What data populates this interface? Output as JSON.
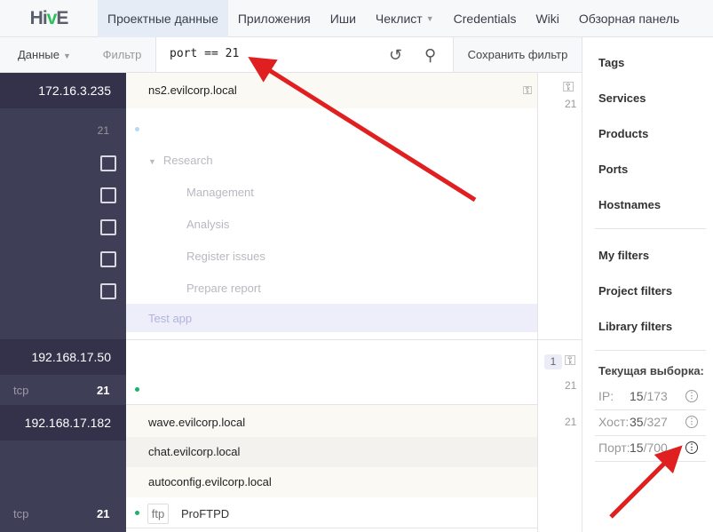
{
  "nav": {
    "logo": "HivE",
    "items": [
      "Проектные данные",
      "Приложения",
      "Иши",
      "Чеклист",
      "Credentials",
      "Wiki",
      "Обзорная панель"
    ]
  },
  "toolbar": {
    "data": "Данные",
    "filter": "Фильтр",
    "query": "port == 21",
    "save": "Сохранить фильтр"
  },
  "rows": [
    {
      "ip": "172.16.3.235",
      "hostnames": [
        "ns2.evilcorp.local"
      ],
      "port": "21",
      "port_count": "21"
    },
    {
      "ip": "192.168.17.50",
      "proto": "tcp",
      "port": "21",
      "badge": "1",
      "port_count": "21"
    },
    {
      "ip": "192.168.17.182",
      "hostnames": [
        "wave.evilcorp.local",
        "chat.evilcorp.local",
        "autoconfig.evilcorp.local"
      ],
      "proto": "tcp",
      "port": "21",
      "service": "ftp",
      "product": "ProFTPD",
      "port_count": "21"
    }
  ],
  "tree": {
    "root": "Research",
    "children": [
      "Management",
      "Analysis",
      "Register issues",
      "Prepare report"
    ],
    "app": "Test app"
  },
  "sidebar": {
    "items": [
      "Tags",
      "Services",
      "Products",
      "Ports",
      "Hostnames"
    ],
    "filters": [
      "My filters",
      "Project filters",
      "Library filters"
    ],
    "selection_title": "Текущая выборка:",
    "stats": [
      {
        "label": "IP:",
        "cur": "15",
        "total": "/173"
      },
      {
        "label": "Хост:",
        "cur": "35",
        "total": "/327"
      },
      {
        "label": "Порт:",
        "cur": "15",
        "total": "/700"
      }
    ]
  },
  "colors": {
    "accent_green": "#2ec25c",
    "arrow": "#e02020",
    "dark": "#33324a"
  }
}
